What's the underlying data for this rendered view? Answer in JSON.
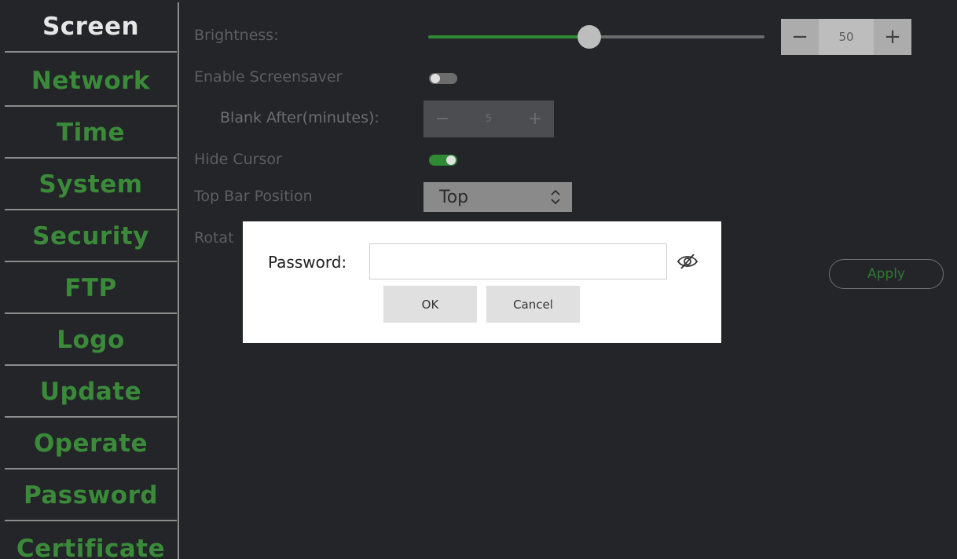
{
  "sidebar": {
    "items": [
      {
        "label": "Screen",
        "active": true
      },
      {
        "label": "Network"
      },
      {
        "label": "Time"
      },
      {
        "label": "System"
      },
      {
        "label": "Security"
      },
      {
        "label": "FTP"
      },
      {
        "label": "Logo"
      },
      {
        "label": "Update"
      },
      {
        "label": "Operate"
      },
      {
        "label": "Password"
      },
      {
        "label": "Certificate"
      }
    ]
  },
  "screen": {
    "brightness": {
      "label": "Brightness:",
      "value": "50",
      "level": 0.5,
      "minus": "−",
      "plus": "+"
    },
    "screensaver": {
      "label": "Enable Screensaver",
      "enabled": false
    },
    "blank_after": {
      "label": "Blank After(minutes):",
      "value": "5",
      "minus": "−",
      "plus": "+"
    },
    "hide_cursor": {
      "label": "Hide Cursor",
      "enabled": true
    },
    "top_bar": {
      "label": "Top Bar Position",
      "value": "Top"
    },
    "rotation": {
      "label": "Rotat"
    },
    "apply_label": "Apply"
  },
  "dialog": {
    "password_label": "Password:",
    "password_value": "",
    "ok_label": "OK",
    "cancel_label": "Cancel",
    "toggle_icon": "eye-slash-icon"
  },
  "colors": {
    "accent": "#2f8a36",
    "sidebar_text": "#3a8a3a",
    "background": "#232528"
  }
}
